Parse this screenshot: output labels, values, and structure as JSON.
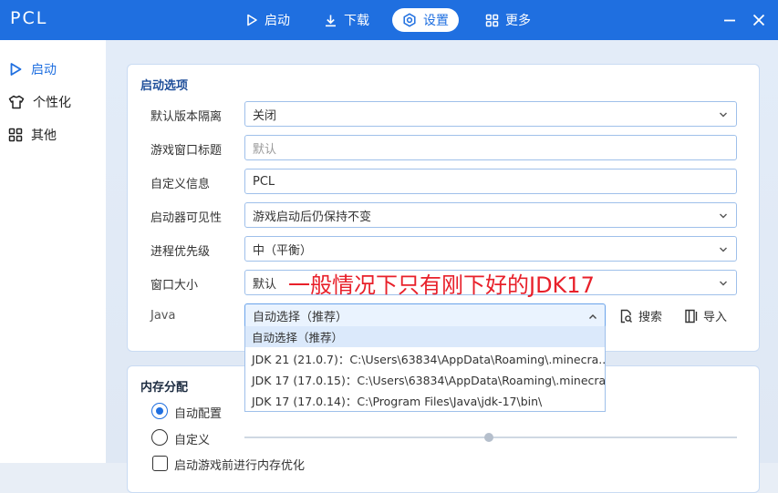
{
  "app": {
    "title": "PCL"
  },
  "nav": [
    {
      "label": "启动",
      "icon": "play-icon"
    },
    {
      "label": "下载",
      "icon": "download-icon"
    },
    {
      "label": "设置",
      "icon": "gear-icon"
    },
    {
      "label": "更多",
      "icon": "grid-icon"
    }
  ],
  "sidebar": {
    "items": [
      {
        "label": "启动",
        "icon": "play-icon"
      },
      {
        "label": "个性化",
        "icon": "shirt-icon"
      },
      {
        "label": "其他",
        "icon": "grid-icon"
      }
    ]
  },
  "launch_options": {
    "title": "启动选项",
    "rows": [
      {
        "label": "默认版本隔离",
        "value": "关闭",
        "type": "select"
      },
      {
        "label": "游戏窗口标题",
        "placeholder": "默认",
        "type": "input"
      },
      {
        "label": "自定义信息",
        "value": "PCL",
        "type": "input"
      },
      {
        "label": "启动器可见性",
        "value": "游戏启动后仍保持不变",
        "type": "select"
      },
      {
        "label": "进程优先级",
        "value": "中（平衡）",
        "type": "select"
      },
      {
        "label": "窗口大小",
        "value": "默认",
        "type": "select"
      }
    ],
    "java": {
      "label": "Java",
      "value": "自动选择（推荐）",
      "options": [
        "自动选择（推荐）",
        "JDK 21 (21.0.7)：C:\\Users\\63834\\AppData\\Roaming\\.minecra...",
        "JDK 17 (17.0.15)：C:\\Users\\63834\\AppData\\Roaming\\.minecra...",
        "JDK 17 (17.0.14)：C:\\Program Files\\Java\\jdk-17\\bin\\"
      ],
      "search_label": "搜索",
      "import_label": "导入"
    },
    "annotation": "一般情况下只有刚下好的JDK17"
  },
  "memory": {
    "title": "内存分配",
    "auto_label": "自动配置",
    "custom_label": "自定义",
    "optimize_label": "启动游戏前进行内存优化"
  },
  "colors": {
    "accent": "#1f6fe0",
    "annotation": "#e8202a"
  }
}
